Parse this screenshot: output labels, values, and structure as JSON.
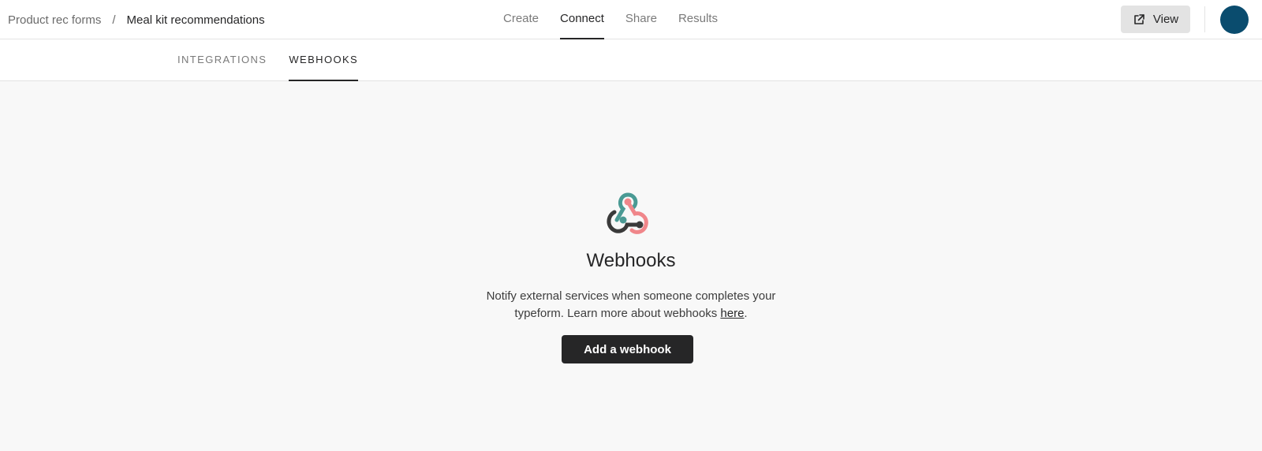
{
  "breadcrumb": {
    "parent": "Product rec forms",
    "separator": "/",
    "current": "Meal kit recommendations"
  },
  "main_tabs": [
    {
      "label": "Create",
      "active": false
    },
    {
      "label": "Connect",
      "active": true
    },
    {
      "label": "Share",
      "active": false
    },
    {
      "label": "Results",
      "active": false
    }
  ],
  "header": {
    "view_label": "View",
    "view_icon": "external-link-icon",
    "avatar_color": "#0a4c6e"
  },
  "sub_tabs": [
    {
      "label": "INTEGRATIONS",
      "active": false
    },
    {
      "label": "WEBHOOKS",
      "active": true
    }
  ],
  "empty_state": {
    "icon": "webhook-icon",
    "title": "Webhooks",
    "description": "Notify external services when someone completes your typeform. Learn more about webhooks ",
    "link_text": "here",
    "link_suffix": ".",
    "button_label": "Add a webhook"
  },
  "colors": {
    "accent_dark": "#262627",
    "webhook_teal": "#4a9a94",
    "webhook_pink": "#f0868a",
    "webhook_dark": "#3a3a3a"
  }
}
